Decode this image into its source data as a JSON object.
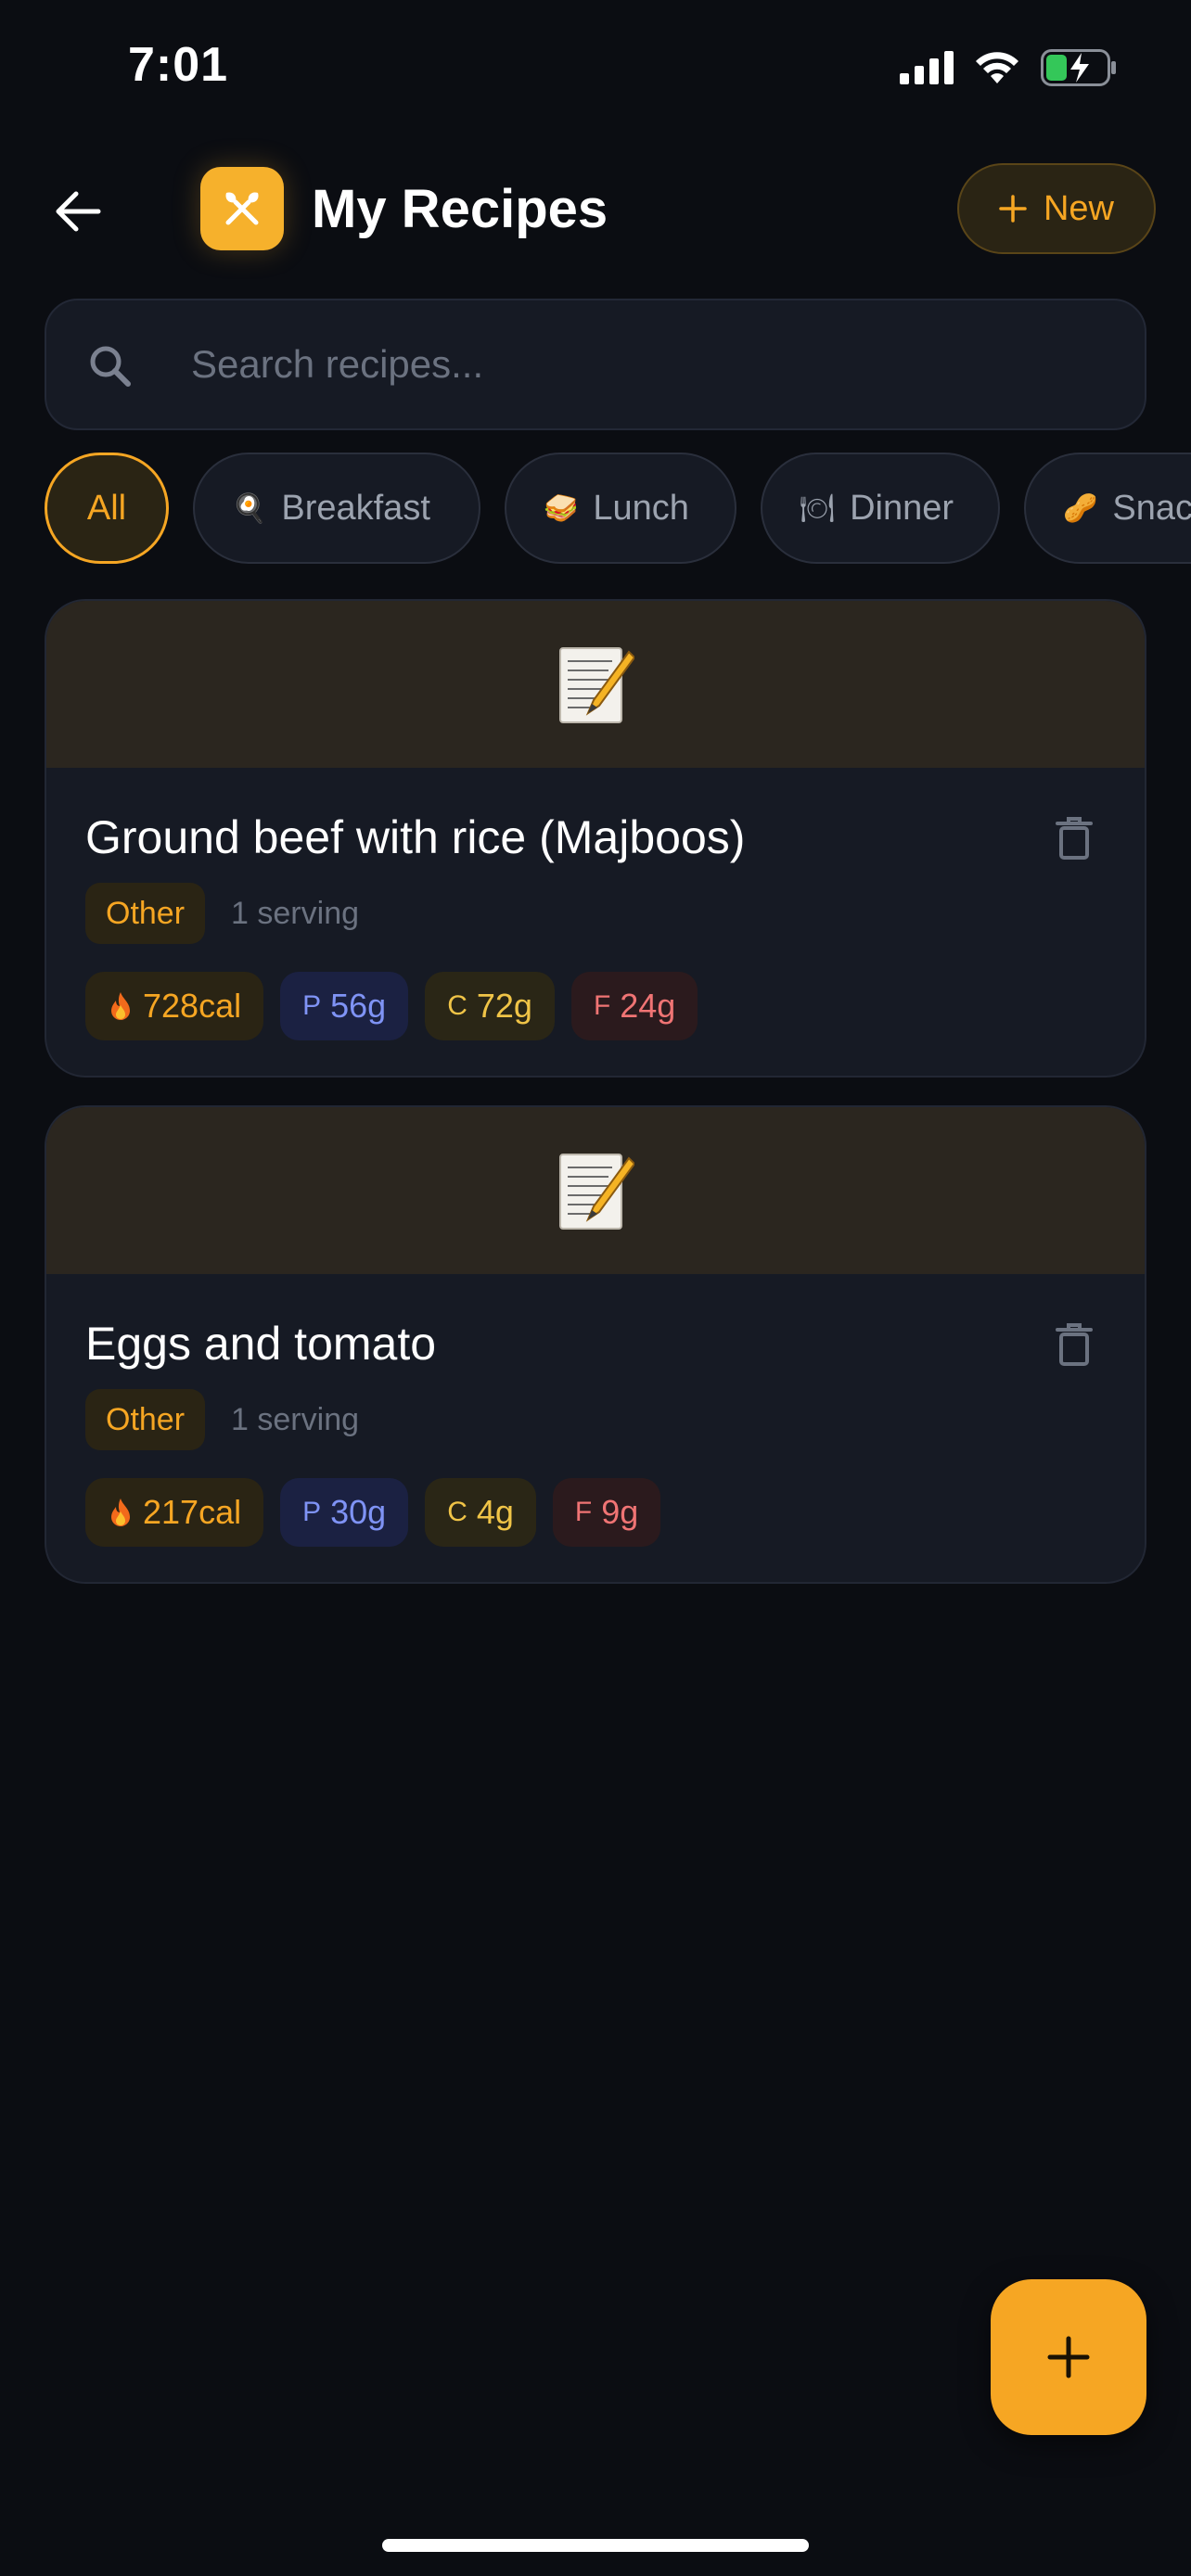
{
  "status_bar": {
    "time": "7:01"
  },
  "header": {
    "title": "My Recipes",
    "new_button_label": "New"
  },
  "search": {
    "placeholder": "Search recipes..."
  },
  "filters": [
    {
      "emoji": "",
      "label": "All",
      "active": true
    },
    {
      "emoji": "🍳",
      "label": "Breakfast",
      "active": false
    },
    {
      "emoji": "🥪",
      "label": "Lunch",
      "active": false
    },
    {
      "emoji": "🍽",
      "label": "Dinner",
      "active": false
    },
    {
      "emoji": "🥜",
      "label": "Snac",
      "active": false
    }
  ],
  "recipes": [
    {
      "emoji": "📝",
      "title": "Ground beef with rice (Majboos)",
      "category": "Other",
      "servings": "1 serving",
      "calories": "728cal",
      "protein_label": "P",
      "protein": "56g",
      "carbs_label": "C",
      "carbs": "72g",
      "fat_label": "F",
      "fat": "24g"
    },
    {
      "emoji": "📝",
      "title": "Eggs and tomato",
      "category": "Other",
      "servings": "1 serving",
      "calories": "217cal",
      "protein_label": "P",
      "protein": "30g",
      "carbs_label": "C",
      "carbs": "4g",
      "fat_label": "F",
      "fat": "9g"
    }
  ],
  "colors": {
    "accent": "#f6a623",
    "background": "#0b0d12",
    "card": "#161a24",
    "protein": "#7f93f5",
    "carbs": "#f0c447",
    "fat": "#f07474"
  },
  "icons": {
    "back": "arrow-left-icon",
    "logo": "fork-knife-icon",
    "search": "search-icon",
    "delete": "trash-icon",
    "fab": "plus-icon"
  }
}
